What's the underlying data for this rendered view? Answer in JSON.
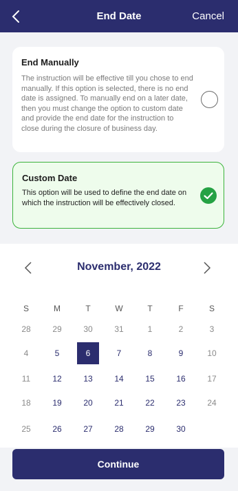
{
  "header": {
    "title": "End Date",
    "cancel_label": "Cancel"
  },
  "option_manual": {
    "title": "End Manually",
    "description": "The instruction will be effective till you chose to end manually. If this option is selected, there is no end date is assigned. To manually end on a later date, then you must change the option to custom date and provide the end date for the instruction to close during the closure of business day.",
    "selected": false
  },
  "option_custom": {
    "title": "Custom Date",
    "description": "This option will be used to define the end date on which the instruction will be effectively closed.",
    "selected": true
  },
  "calendar": {
    "month_label": "November, 2022",
    "weekdays": [
      "S",
      "M",
      "T",
      "W",
      "T",
      "F",
      "S"
    ],
    "selected_day": "6",
    "weeks": [
      [
        {
          "d": "28",
          "cur": false
        },
        {
          "d": "29",
          "cur": false
        },
        {
          "d": "30",
          "cur": false
        },
        {
          "d": "31",
          "cur": false
        },
        {
          "d": "1",
          "cur": false
        },
        {
          "d": "2",
          "cur": false
        },
        {
          "d": "3",
          "cur": false
        }
      ],
      [
        {
          "d": "4",
          "cur": false
        },
        {
          "d": "5",
          "cur": true
        },
        {
          "d": "6",
          "cur": true,
          "sel": true
        },
        {
          "d": "7",
          "cur": true
        },
        {
          "d": "8",
          "cur": true
        },
        {
          "d": "9",
          "cur": true
        },
        {
          "d": "10",
          "cur": false
        }
      ],
      [
        {
          "d": "11",
          "cur": false
        },
        {
          "d": "12",
          "cur": true
        },
        {
          "d": "13",
          "cur": true
        },
        {
          "d": "14",
          "cur": true
        },
        {
          "d": "15",
          "cur": true
        },
        {
          "d": "16",
          "cur": true
        },
        {
          "d": "17",
          "cur": false
        }
      ],
      [
        {
          "d": "18",
          "cur": false
        },
        {
          "d": "19",
          "cur": true
        },
        {
          "d": "20",
          "cur": true
        },
        {
          "d": "21",
          "cur": true
        },
        {
          "d": "22",
          "cur": true
        },
        {
          "d": "23",
          "cur": true
        },
        {
          "d": "24",
          "cur": false
        }
      ],
      [
        {
          "d": "25",
          "cur": false
        },
        {
          "d": "26",
          "cur": true
        },
        {
          "d": "27",
          "cur": true
        },
        {
          "d": "28",
          "cur": true
        },
        {
          "d": "29",
          "cur": true
        },
        {
          "d": "30",
          "cur": true
        }
      ]
    ]
  },
  "colors": {
    "primary": "#2b2d6e",
    "success": "#25a244",
    "success_bg": "#eefcec"
  },
  "icons": {
    "back": "chevron-left-icon",
    "prev": "chevron-left-icon",
    "next": "chevron-right-icon",
    "check": "check-icon"
  },
  "continue_label": "Continue"
}
